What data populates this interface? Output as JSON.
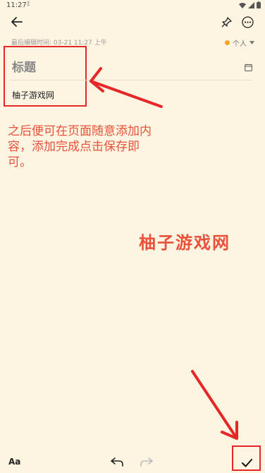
{
  "status_bar": {
    "time": "11:27",
    "indicator": "⁒"
  },
  "top_bar": {
    "back_icon": "back-arrow-icon",
    "pin_icon": "pin-icon",
    "more_icon": "more-icon"
  },
  "meta": {
    "last_edit": "最后编辑时间: 03-21 11:27 上午",
    "folder_label": "个人"
  },
  "note": {
    "title_placeholder": "标题",
    "content": "柚子游戏网"
  },
  "annotation": {
    "instruction": "之后便可在页面随意添加内容，添加完成点击保存即可。",
    "watermark": "柚子游戏网",
    "color": "#e8523a"
  },
  "bottom_bar": {
    "format_label": "Aa"
  },
  "colors": {
    "background": "#fdf4e2",
    "highlight": "#e52727",
    "folder_dot": "#f4a622"
  }
}
